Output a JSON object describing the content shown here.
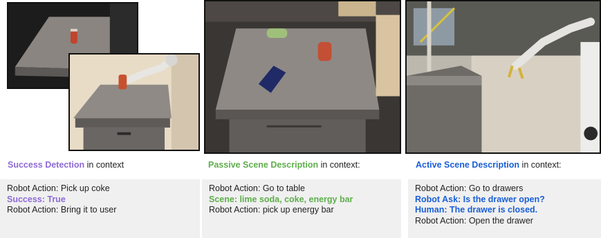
{
  "colors": {
    "purple": "#8e6bd6",
    "green": "#5fae4d",
    "blue": "#1a5fd6",
    "textbox_bg": "#f0f0f0"
  },
  "panels": [
    {
      "heading_highlight": "Success Detection",
      "heading_rest": " in context",
      "lines": [
        {
          "text": "Robot Action: Pick up coke",
          "style": "plain"
        },
        {
          "text": "Success: True",
          "style": "purple"
        },
        {
          "text": "Robot Action: Bring it to user",
          "style": "plain"
        }
      ]
    },
    {
      "heading_highlight": "Passive Scene Description",
      "heading_rest": " in context:",
      "lines": [
        {
          "text": "Robot Action: Go to table",
          "style": "plain"
        },
        {
          "text": "Scene: lime soda, coke, energy bar",
          "style": "green"
        },
        {
          "text": "Robot Action: pick up energy bar",
          "style": "plain"
        }
      ]
    },
    {
      "heading_highlight": "Active Scene Description",
      "heading_rest": " in context:",
      "lines": [
        {
          "text": "Robot Action: Go to drawers",
          "style": "plain"
        },
        {
          "text": "Robot Ask: Is the drawer open?",
          "style": "blue"
        },
        {
          "text": "Human: The drawer is closed.",
          "style": "blue"
        },
        {
          "text": "Robot Action: Open the drawer",
          "style": "plain"
        }
      ]
    }
  ]
}
